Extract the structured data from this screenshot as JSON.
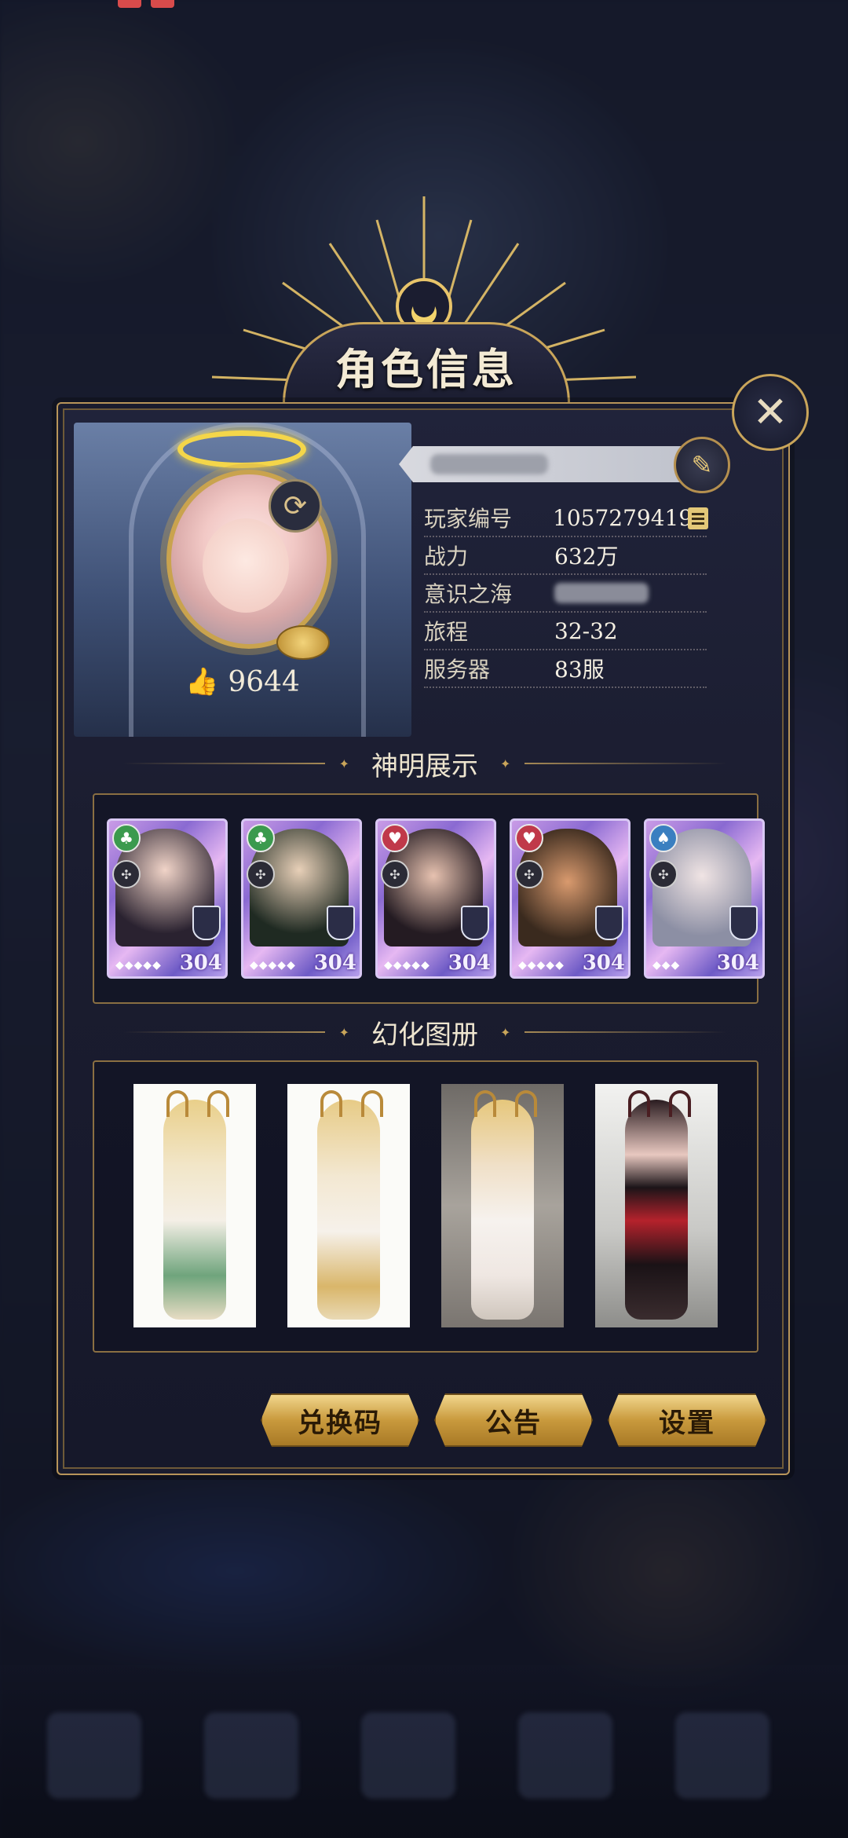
{
  "panel": {
    "title": "角色信息"
  },
  "profile": {
    "likes": "9644",
    "info": [
      {
        "label": "玩家编号",
        "value": "10572794196"
      },
      {
        "label": "战力",
        "value": "632万"
      },
      {
        "label": "意识之海",
        "value": ""
      },
      {
        "label": "旅程",
        "value": "32-32"
      },
      {
        "label": "服务器",
        "value": "83服"
      }
    ]
  },
  "sections": {
    "heroes": "神明展示",
    "skins": "幻化图册"
  },
  "heroes": [
    {
      "suit": "♣",
      "suit_color": "#3b9a4e",
      "level": "304"
    },
    {
      "suit": "♣",
      "suit_color": "#3b9a4e",
      "level": "304"
    },
    {
      "suit": "♥",
      "suit_color": "#c0394a",
      "level": "304"
    },
    {
      "suit": "♥",
      "suit_color": "#c0394a",
      "level": "304"
    },
    {
      "suit": "♠",
      "suit_color": "#3a7fc0",
      "level": "304"
    }
  ],
  "buttons": {
    "redeem": "兑换码",
    "notice": "公告",
    "settings": "设置"
  },
  "icons": {
    "close": "close-icon",
    "refresh": "refresh-icon",
    "edit": "quill-edit-icon",
    "copy": "copy-icon",
    "like": "thumbs-up-icon"
  },
  "colors": {
    "accent_gold": "#c9a55a",
    "panel_bg": "#1b1d30"
  }
}
